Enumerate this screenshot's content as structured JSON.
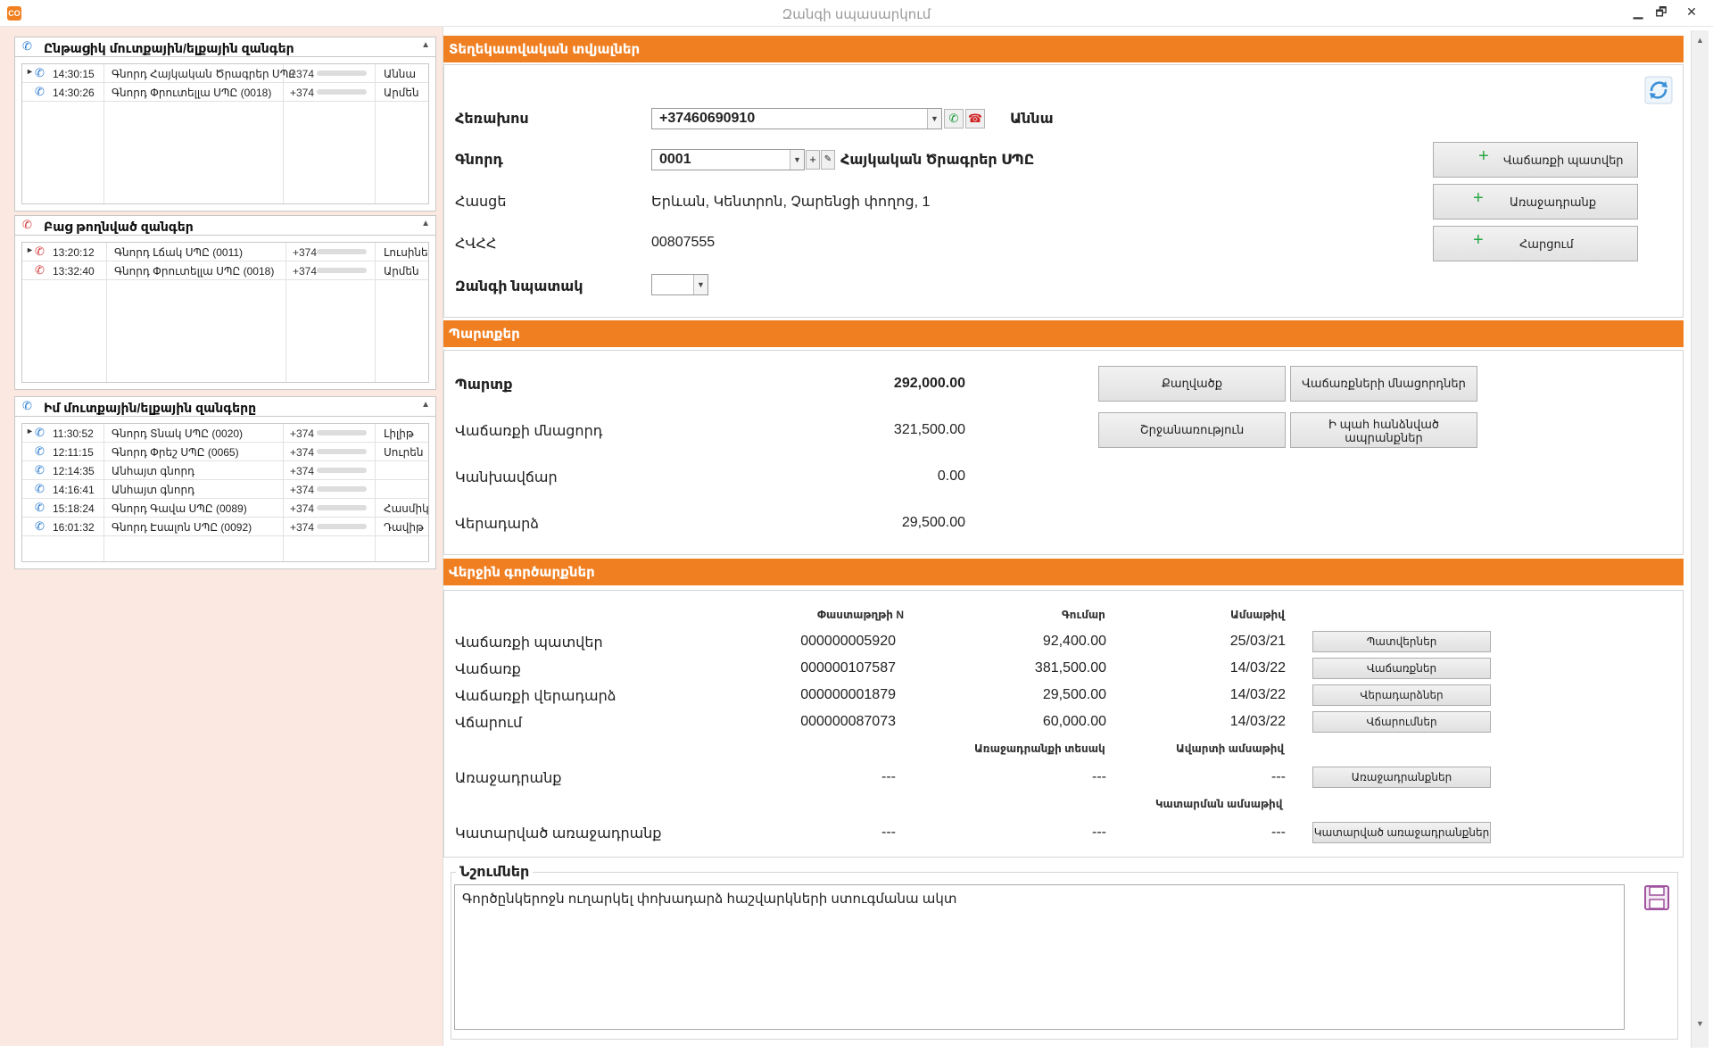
{
  "window": {
    "title": "Զանգի սպասարկում",
    "app_icon": "CO",
    "minimize": "▁",
    "restore": "🗗",
    "close": "✕"
  },
  "left": {
    "recent_calls": {
      "title": "Ընթացիկ մուտքային/ելքային զանգեր",
      "rows": [
        {
          "time": "14:30:15",
          "name": "Գնորդ Հայկական Ծրագրեր ՍՊԸ",
          "phone": "+374",
          "agent": "Աննա",
          "icon": "incoming-call-icon"
        },
        {
          "time": "14:30:26",
          "name": "Գնորդ Փրուտելլա ՍՊԸ (0018)",
          "phone": "+374",
          "agent": "Արմեն",
          "icon": "incoming-call-icon"
        }
      ]
    },
    "missed_calls": {
      "title": "Բաց թողնված զանգեր",
      "rows": [
        {
          "time": "13:20:12",
          "name": "Գնորդ Լճակ ՍՊԸ (0011)",
          "phone": "+374",
          "agent": "Լուսինե",
          "icon": "missed-call-icon"
        },
        {
          "time": "13:32:40",
          "name": "Գնորդ Փրուտելլա ՍՊԸ (0018)",
          "phone": "+374",
          "agent": "Արմեն",
          "icon": "missed-call-icon"
        }
      ]
    },
    "my_calls": {
      "title": "Իմ մուտքային/ելքային զանգերը",
      "rows": [
        {
          "time": "11:30:52",
          "name": "Գնորդ Տնակ ՍՊԸ (0020)",
          "phone": "+374",
          "agent": "Լիլիթ",
          "icon": "incoming-call-icon"
        },
        {
          "time": "12:11:15",
          "name": "Գնորդ Փրեշ ՍՊԸ (0065)",
          "phone": "+374",
          "agent": "Սուրեն",
          "icon": "incoming-call-icon"
        },
        {
          "time": "12:14:35",
          "name": "Անհայտ գնորդ",
          "phone": "+374",
          "agent": "",
          "icon": "outgoing-call-icon"
        },
        {
          "time": "14:16:41",
          "name": "Անհայտ գնորդ",
          "phone": "+374",
          "agent": "",
          "icon": "outgoing-call-icon"
        },
        {
          "time": "15:18:24",
          "name": "Գնորդ Գավա ՍՊԸ (0089)",
          "phone": "+374",
          "agent": "Հասմիկ",
          "icon": "incoming-call-icon"
        },
        {
          "time": "16:01:32",
          "name": "Գնորդ Էսալոն ՍՊԸ (0092)",
          "phone": "+374",
          "agent": "Դավիթ",
          "icon": "outgoing-call-icon"
        }
      ]
    }
  },
  "info": {
    "title": "Տեղեկատվական տվյալներ",
    "phone_label": "Հեռախոս",
    "phone_value": "+37460690910",
    "phone_contact": "Աննա",
    "customer_label": "Գնորդ",
    "customer_code": "0001",
    "customer_name": "Հայկական Ծրագրեր ՍՊԸ",
    "address_label": "Հասցե",
    "address_value": "Երևան, Կենտրոն, Չարենցի փողոց, 1",
    "tin_label": "ՀՎՀՀ",
    "tin_value": "00807555",
    "purpose_label": "Զանգի նպատակ",
    "btn_sales_order": "Վաճառքի պատվեր",
    "btn_offer": "Առաջադրանք",
    "btn_query": "Հարցում"
  },
  "debts": {
    "title": "Պարտքեր",
    "rows": [
      {
        "label": "Պարտք",
        "value": "292,000.00"
      },
      {
        "label": "Վաճառքի մնացորդ",
        "value": "321,500.00"
      },
      {
        "label": "Կանխավճար",
        "value": "0.00"
      },
      {
        "label": "Վերադարձ",
        "value": "29,500.00"
      }
    ],
    "btn_statement": "Քաղվածք",
    "btn_sales_balances": "Վաճառքների մնացորդներ",
    "btn_turnover": "Շրջանառություն",
    "btn_reserved_goods": "Ի պահ հանձնված ապրանքներ"
  },
  "recent_ops": {
    "title": "Վերջին գործարքներ",
    "col_doc": "Փաստաթղթի N",
    "col_amount": "Գումար",
    "col_date": "Ամսաթիվ",
    "rows": [
      {
        "label": "Վաճառքի պատվեր",
        "doc": "000000005920",
        "amount": "92,400.00",
        "date": "25/03/21",
        "btn": "Պատվերներ"
      },
      {
        "label": "Վաճառք",
        "doc": "000000107587",
        "amount": "381,500.00",
        "date": "14/03/22",
        "btn": "Վաճառքներ"
      },
      {
        "label": "Վաճառքի վերադարձ",
        "doc": "000000001879",
        "amount": "29,500.00",
        "date": "14/03/22",
        "btn": "Վերադարձներ"
      },
      {
        "label": "Վճարում",
        "doc": "000000087073",
        "amount": "60,000.00",
        "date": "14/03/22",
        "btn": "Վճարումներ"
      }
    ],
    "col_task_type": "Առաջադրանքի տեսակ",
    "col_end_date": "Ավարտի ամսաթիվ",
    "task_label": "Առաջադրանք",
    "task_doc": "---",
    "task_type": "---",
    "task_date": "---",
    "task_btn": "Առաջադրանքներ",
    "col_done_date": "Կատարման ամսաթիվ",
    "done_label": "Կատարված առաջադրանք",
    "done_doc": "---",
    "done_type": "---",
    "done_date": "---",
    "done_btn": "Կատարված առաջադրանքներ"
  },
  "notes": {
    "title": "Նշումներ",
    "text": "Գործընկերոջն ուղարկել փոխադարձ հաշվարկների ստուգմանա ակտ"
  },
  "colors": {
    "accent": "#f07f22",
    "left_bg": "#fbe9e1"
  }
}
